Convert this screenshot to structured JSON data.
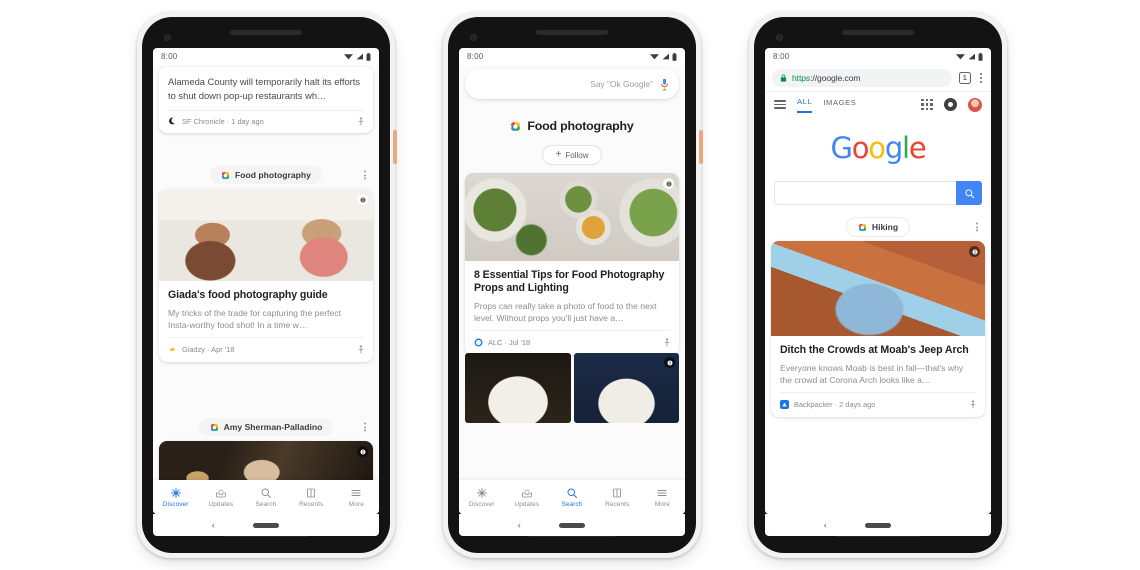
{
  "scene": {
    "background": "#ffffff",
    "accent_blue": "#1a73e8",
    "google_blue": "#4285f4",
    "google_red": "#ea4335",
    "google_yellow": "#fbbc05",
    "google_green": "#34a853",
    "side_button_color": "#e8a97c"
  },
  "nav": {
    "items": [
      {
        "label": "Discover",
        "icon": "discover-sparkle-icon"
      },
      {
        "label": "Updates",
        "icon": "updates-tray-icon"
      },
      {
        "label": "Search",
        "icon": "search-magnifier-icon"
      },
      {
        "label": "Recents",
        "icon": "recents-book-icon"
      },
      {
        "label": "More",
        "icon": "more-hamburger-icon"
      }
    ]
  },
  "phone1": {
    "status": {
      "time": "8:00",
      "icons": [
        "wifi-icon",
        "signal-icon",
        "battery-icon"
      ]
    },
    "news_card": {
      "headline": "Alameda County will temporarily halt its efforts to shut down pop-up restaurants wh…",
      "source": "SF Chronicle · 1 day ago",
      "source_icon": "sf-chronicle-icon",
      "share_icon": "share-icon"
    },
    "topic_chip": {
      "label": "Food photography",
      "icon": "google-dot-icon"
    },
    "menu_icon": "kebab-menu-icon",
    "article": {
      "image": "two-women-photographing-food-in-kitchen",
      "image_badge_icon": "info-badge-icon",
      "title": "Giada's food photography guide",
      "description": "My tricks of the trade for capturing the perfect Insta-worthy food shot! In a time w…",
      "source": "Giadzy · Apr '18",
      "source_icon": "giadzy-icon",
      "share_icon": "share-icon"
    },
    "topic_chip2": {
      "label": "Amy Sherman-Palladino",
      "icon": "google-dot-icon"
    },
    "next_image": "woman-in-top-hat-dark-scene",
    "next_image_badge_icon": "info-badge-icon",
    "active_nav": "Discover",
    "system_bar": {
      "back_icon": "back-chevron-icon",
      "home_icon": "home-pill-icon"
    }
  },
  "phone2": {
    "status": {
      "time": "8:00",
      "icons": [
        "wifi-icon",
        "signal-icon",
        "battery-icon"
      ]
    },
    "search": {
      "placeholder": "Say \"Ok Google\"",
      "mic_icon": "microphone-icon"
    },
    "topic_header": {
      "label": "Food photography",
      "icon": "google-dot-icon"
    },
    "follow_button": {
      "label": "Follow",
      "icon": "plus-icon"
    },
    "article": {
      "image": "three-bowls-of-salad-overhead",
      "image_badge_icon": "info-badge-icon",
      "title": "8 Essential Tips for Food Photography Props and Lighting",
      "description": "Props can really take a photo of food to the next level. Without props you'll just have a…",
      "source": "ALC · Jul '18",
      "source_icon": "alc-icon",
      "share_icon": "share-icon"
    },
    "thumbnails": [
      {
        "image": "plate-of-food-dark-background"
      },
      {
        "image": "plate-of-food-blue-background",
        "badge_icon": "info-badge-icon"
      }
    ],
    "active_nav": "Search",
    "system_bar": {
      "back_icon": "back-chevron-icon",
      "home_icon": "home-pill-icon"
    }
  },
  "phone3": {
    "status": {
      "time": "8:00",
      "icons": [
        "wifi-icon",
        "signal-icon",
        "battery-icon"
      ]
    },
    "omnibox": {
      "lock_icon": "lock-icon",
      "url_scheme": "https",
      "url_separator": "://",
      "url_host": "google.com",
      "tab_count": "1",
      "menu_icon": "chrome-menu-icon"
    },
    "google_tabs": {
      "hamburger_icon": "hamburger-menu-icon",
      "tabs": [
        {
          "label": "ALL",
          "active": true
        },
        {
          "label": "IMAGES",
          "active": false
        }
      ],
      "apps_icon": "apps-grid-icon",
      "assistant_icon": "assistant-icon",
      "avatar_icon": "user-avatar"
    },
    "logo": {
      "letters": [
        "G",
        "o",
        "o",
        "g",
        "l",
        "e"
      ]
    },
    "searchbox": {
      "value": "",
      "search_icon": "search-magnifier-icon"
    },
    "topic_chip": {
      "label": "Hiking",
      "icon": "google-dot-icon"
    },
    "menu_icon": "kebab-menu-icon",
    "article": {
      "image": "red-rock-arch-moab-landscape",
      "image_badge_icon": "info-badge-icon",
      "title": "Ditch the Crowds at Moab's Jeep Arch",
      "description": "Everyone knows Moab is best in fall—that's why the crowd at Corona Arch looks like a…",
      "source": "Backpacker · 2 days ago",
      "source_icon": "backpacker-icon",
      "share_icon": "share-icon"
    },
    "system_bar": {
      "back_icon": "back-chevron-icon",
      "home_icon": "home-pill-icon"
    }
  }
}
